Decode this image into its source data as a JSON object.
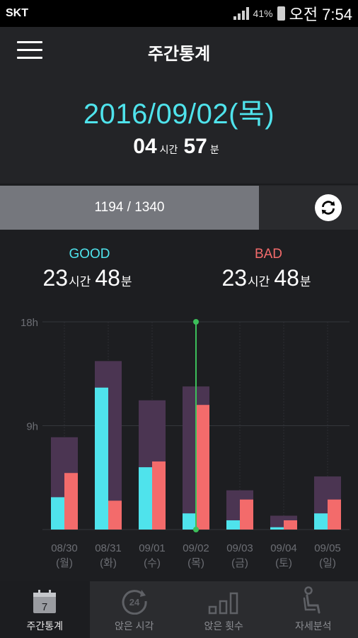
{
  "status_bar": {
    "carrier": "SKT",
    "battery": "41%",
    "time": "오전 7:54"
  },
  "app_bar": {
    "title": "주간통계"
  },
  "summary": {
    "date": "2016/09/02(목)",
    "hours": "04",
    "hours_unit": "시간",
    "minutes": "57",
    "minutes_unit": "분"
  },
  "progress": {
    "text": "1194 / 1340",
    "current": 1194,
    "total": 1340
  },
  "stats": {
    "good_label": "GOOD",
    "good_hours": "23",
    "good_minutes": "48",
    "bad_label": "BAD",
    "bad_hours": "23",
    "bad_minutes": "48",
    "hours_unit": "시간",
    "minutes_unit": "분"
  },
  "colors": {
    "accent": "#4fe3ec",
    "good": "#4fe3ec",
    "bad": "#f36b6b",
    "total": "#4b3552",
    "selected": "#3cbf5a"
  },
  "chart_data": {
    "type": "bar",
    "categories": [
      "08/30",
      "08/31",
      "09/01",
      "09/02",
      "09/03",
      "09/04",
      "09/05"
    ],
    "weekday_labels": [
      "(월)",
      "(화)",
      "(수)",
      "(목)",
      "(금)",
      "(토)",
      "(일)"
    ],
    "ytick_labels": [
      "18h",
      "9h"
    ],
    "yticks": [
      18,
      9
    ],
    "ylim": [
      0,
      18
    ],
    "total": [
      8.0,
      14.6,
      11.2,
      12.4,
      3.4,
      1.2,
      4.6
    ],
    "series": [
      {
        "values": [
          2.8,
          12.3,
          5.4,
          1.4,
          0.8,
          0.2,
          1.4
        ]
      },
      {
        "values": [
          4.9,
          2.5,
          5.9,
          10.8,
          2.6,
          0.8,
          2.6
        ]
      }
    ],
    "selected_index": 3,
    "grid": true
  },
  "tabs": [
    {
      "label": "주간통계",
      "icon": "calendar-icon",
      "badge": "7"
    },
    {
      "label": "앉은 시각",
      "icon": "clock-24-icon",
      "badge": "24"
    },
    {
      "label": "앉은 횟수",
      "icon": "bar-chart-icon",
      "badge": ""
    },
    {
      "label": "자세분석",
      "icon": "sitting-person-icon",
      "badge": ""
    }
  ]
}
